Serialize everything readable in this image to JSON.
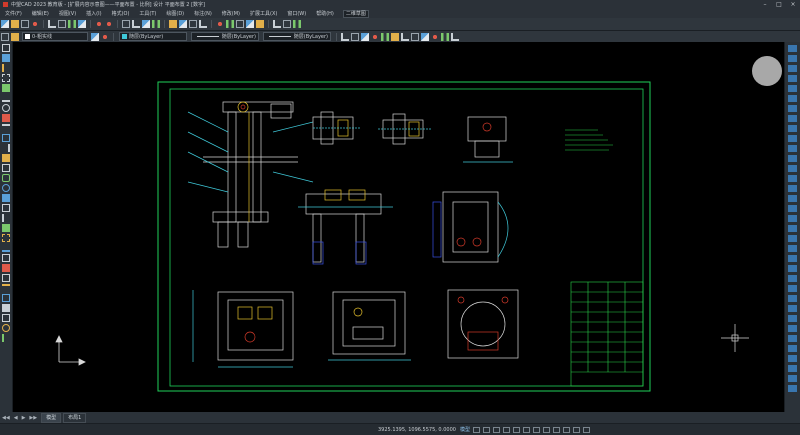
{
  "window": {
    "title": "中望CAD 2023 教育版 - [扩展内容示意图——平面布置 - 比例] 设计 平面布置 2 [数字]"
  },
  "menu": {
    "items": [
      "文件(F)",
      "编辑(E)",
      "视图(V)",
      "插入(I)",
      "格式(O)",
      "工具(T)",
      "绘图(D)",
      "标注(N)",
      "修改(M)",
      "扩展工具(X)",
      "窗口(W)",
      "帮助(H)"
    ],
    "workspace": "二维草图"
  },
  "toolbar": {
    "layer_name": "0-粗实线",
    "color_label": "随层(ByLayer)",
    "linetype_label": "随层(ByLayer)",
    "lineweight_label": "随层(ByLayer)"
  },
  "tabs": {
    "items": [
      "模型",
      "布局1"
    ],
    "active_index": 0
  },
  "status": {
    "coordinates": "3925.1395, 1096.5575, 0.0000",
    "mode": "模型"
  },
  "colors": {
    "frame": "#1fd15a",
    "drawing": "#d8d8d8",
    "annotation": "#2ad34a",
    "yellow": "#e6c12c",
    "blue": "#3a52e6",
    "red": "#d33a2a",
    "cyan": "#3fc8d8"
  }
}
